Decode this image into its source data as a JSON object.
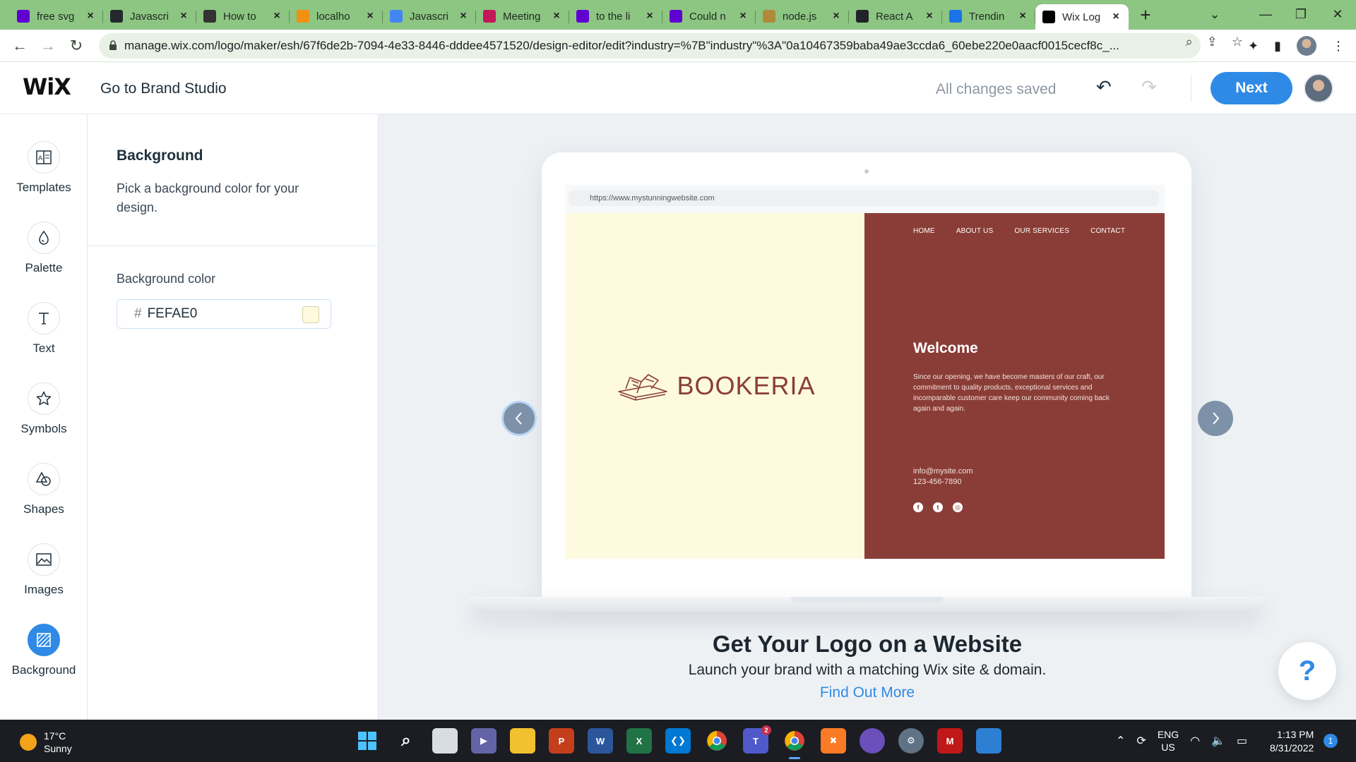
{
  "browser": {
    "tabs": [
      {
        "label": "free svg",
        "icon": "yahoo-icon",
        "color": "#6001d2"
      },
      {
        "label": "Javascri",
        "icon": "github-icon",
        "color": "#24292e"
      },
      {
        "label": "How to",
        "icon": "cat-icon",
        "color": "#333333"
      },
      {
        "label": "localho",
        "icon": "phpmyadmin-icon",
        "color": "#f29111"
      },
      {
        "label": "Javascri",
        "icon": "docs-icon",
        "color": "#4285f4"
      },
      {
        "label": "Meeting",
        "icon": "play-icon",
        "color": "#c2185b"
      },
      {
        "label": "to the li",
        "icon": "yahoo-icon",
        "color": "#6001d2"
      },
      {
        "label": "Could n",
        "icon": "yahoo-icon",
        "color": "#6001d2"
      },
      {
        "label": "node.js",
        "icon": "pencil-icon",
        "color": "#b08a3a"
      },
      {
        "label": "React A",
        "icon": "react-icon",
        "color": "#20232a"
      },
      {
        "label": "Trendin",
        "icon": "trending-icon",
        "color": "#1a73e8"
      },
      {
        "label": "Wix Log",
        "icon": "wix-icon",
        "color": "#000000",
        "active": true
      }
    ],
    "url": "manage.wix.com/logo/maker/esh/67f6de2b-7094-4e33-8446-dddee4571520/design-editor/edit?industry=%7B\"industry\"%3A\"0a10467359baba49ae3ccda6_60ebe220e0aacf0015cecf8c_..."
  },
  "header": {
    "logo": "WiX",
    "brand_studio": "Go to Brand Studio",
    "status": "All changes saved",
    "next_label": "Next"
  },
  "rail": [
    {
      "label": "Templates",
      "icon": "templates-icon"
    },
    {
      "label": "Palette",
      "icon": "palette-icon"
    },
    {
      "label": "Text",
      "icon": "text-icon"
    },
    {
      "label": "Symbols",
      "icon": "star-icon"
    },
    {
      "label": "Shapes",
      "icon": "shapes-icon"
    },
    {
      "label": "Images",
      "icon": "image-icon"
    },
    {
      "label": "Background",
      "icon": "background-icon",
      "active": true
    }
  ],
  "panel": {
    "title": "Background",
    "description": "Pick a background color for your design.",
    "field_label": "Background color",
    "hash": "#",
    "color_value": "FEFAE0",
    "swatch_color": "#fefae0"
  },
  "preview": {
    "site_url": "https://www.mystunningwebsite.com",
    "left_bg": "#fefae0",
    "right_bg": "#8a3d36",
    "logo_text": "BOOKERIA",
    "logo_color": "#8a3d36",
    "nav": [
      "HOME",
      "ABOUT US",
      "OUR SERVICES",
      "CONTACT"
    ],
    "welcome": "Welcome",
    "welcome_text": "Since our opening, we have become masters of our craft, our commitment to quality products, exceptional services and incomparable customer care keep our community coming back again and again.",
    "email": "info@mysite.com",
    "phone": "123-456-7890"
  },
  "promo": {
    "title": "Get Your Logo on a Website",
    "subtitle": "Launch your brand with a matching Wix site & domain.",
    "link": "Find Out More",
    "help": "?"
  },
  "taskbar": {
    "temperature": "17°C",
    "condition": "Sunny",
    "lang_top": "ENG",
    "lang_bottom": "US",
    "time": "1:13 PM",
    "date": "8/31/2022",
    "notifications": "1",
    "teams_badge": "2"
  },
  "colors": {
    "accent": "#2f8ae6",
    "tabstrip": "#8dc583"
  }
}
